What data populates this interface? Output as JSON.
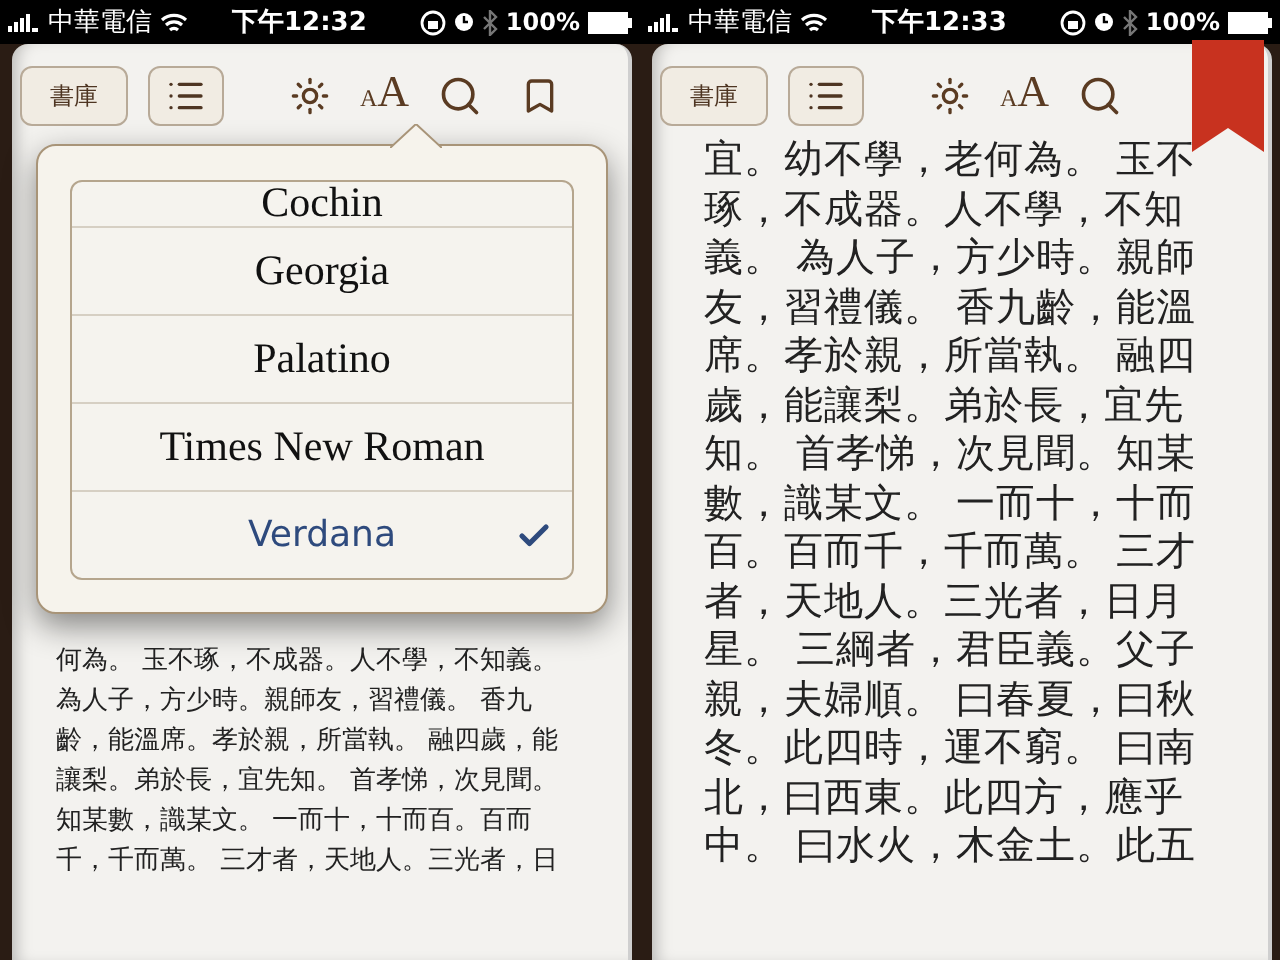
{
  "screens": [
    {
      "kind": "font_menu",
      "status_bar": {
        "carrier": "中華電信",
        "time": "下午12:32",
        "battery": "100%"
      },
      "toolbar": {
        "library_button": "書庫",
        "font_button": [
          "A",
          "A"
        ],
        "bookmarked": false
      },
      "font_menu": {
        "items": [
          {
            "label": "Cochin",
            "selected": false
          },
          {
            "label": "Georgia",
            "selected": false
          },
          {
            "label": "Palatino",
            "selected": false
          },
          {
            "label": "Times New Roman",
            "selected": false
          },
          {
            "label": "Verdana",
            "selected": true
          }
        ]
      },
      "lines": [
        "何為。 玉不琢，不成器。人不學，不知義。",
        "為人子，方少時。親師友，習禮儀。 香九",
        "齡，能溫席。孝於親，所當執。 融四歲，能",
        "讓梨。弟於長，宜先知。 首孝悌，次見聞。",
        "知某數，識某文。 一而十，十而百。百而",
        "千，千而萬。 三才者，天地人。三光者，日"
      ]
    },
    {
      "kind": "reading",
      "status_bar": {
        "carrier": "中華電信",
        "time": "下午12:33",
        "battery": "100%"
      },
      "toolbar": {
        "library_button": "書庫",
        "font_button": [
          "A",
          "A"
        ],
        "bookmarked": true
      },
      "lines": [
        "宜。幼不學，老何為。 玉不",
        "琢，不成器。人不學，不知",
        "義。 為人子，方少時。親師",
        "友，習禮儀。 香九齡，能溫",
        "席。孝於親，所當執。 融四",
        "歲，能讓梨。弟於長，宜先",
        "知。 首孝悌，次見聞。知某",
        "數，識某文。 一而十，十而",
        "百。百而千，千而萬。 三才",
        "者，天地人。三光者，日月",
        "星。 三綱者，君臣義。父子",
        "親，夫婦順。 曰春夏，曰秋",
        "冬。此四時，運不窮。 曰南",
        "北，曰西東。此四方，應乎",
        "中。 曰水火，木金土。此五"
      ]
    }
  ]
}
